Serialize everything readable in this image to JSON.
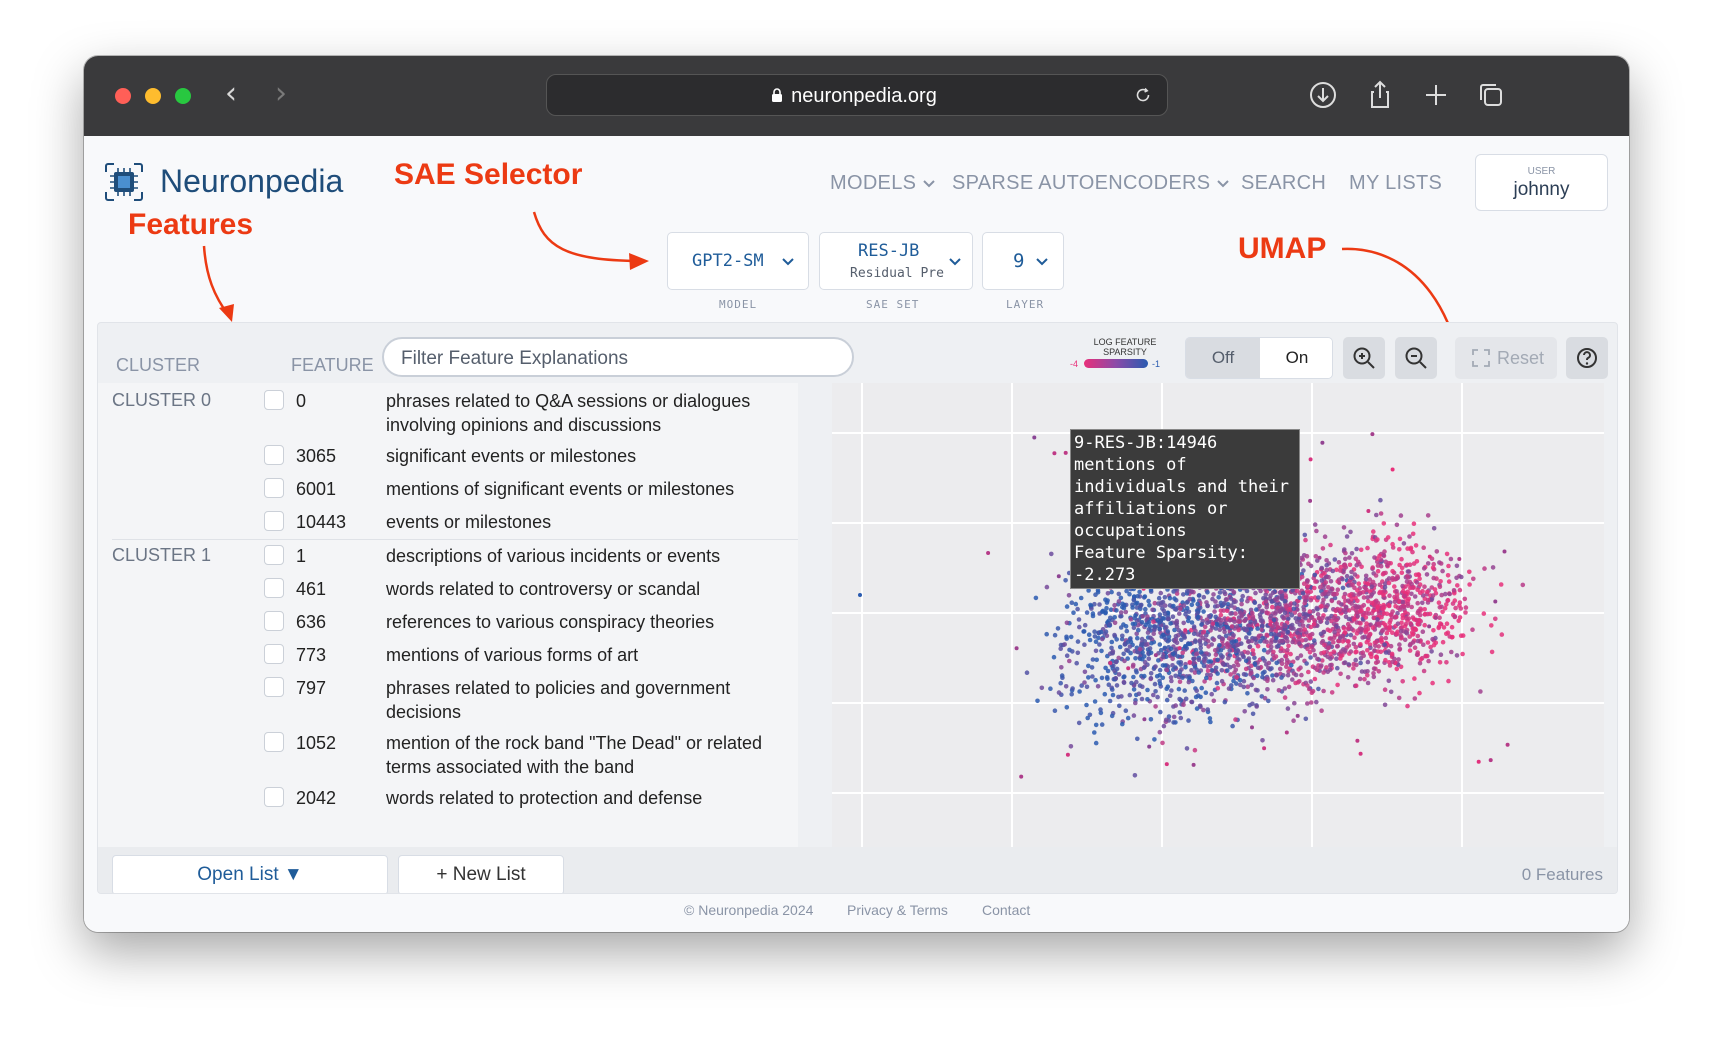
{
  "browser": {
    "url": "neuronpedia.org",
    "icons": [
      "back-icon",
      "forward-icon",
      "lock-icon",
      "reload-icon",
      "download-icon",
      "share-icon",
      "new-tab-icon",
      "tabs-icon"
    ]
  },
  "header": {
    "brand": "Neuronpedia",
    "nav": {
      "models": "MODELS",
      "sparse_autoencoders": "SPARSE AUTOENCODERS",
      "search": "SEARCH",
      "my_lists": "MY LISTS"
    },
    "user": {
      "label": "USER",
      "name": "johnny"
    }
  },
  "annotations": {
    "sae_selector": "SAE Selector",
    "features": "Features",
    "umap": "UMAP",
    "color": "#ec3a13"
  },
  "selectors": {
    "model": {
      "value": "GPT2-SM",
      "label": "MODEL"
    },
    "sae_set": {
      "value": "RES-JB",
      "sub": "Residual Pre",
      "label": "SAE SET"
    },
    "layer": {
      "value": "9",
      "label": "LAYER"
    }
  },
  "feature_list": {
    "cluster_header": "CLUSTER",
    "feature_header": "FEATURE",
    "filter_placeholder": "Filter Feature Explanations",
    "clusters": [
      {
        "name": "CLUSTER 0",
        "features": [
          {
            "id": "0",
            "desc": "phrases related to Q&A sessions or dialogues involving opinions and discussions"
          },
          {
            "id": "3065",
            "desc": "significant events or milestones"
          },
          {
            "id": "6001",
            "desc": "mentions of significant events or milestones"
          },
          {
            "id": "10443",
            "desc": "events or milestones"
          }
        ]
      },
      {
        "name": "CLUSTER 1",
        "features": [
          {
            "id": "1",
            "desc": "descriptions of various incidents or events"
          },
          {
            "id": "461",
            "desc": "words related to controversy or scandal"
          },
          {
            "id": "636",
            "desc": "references to various conspiracy theories"
          },
          {
            "id": "773",
            "desc": "mentions of various forms of art"
          },
          {
            "id": "797",
            "desc": "phrases related to policies and government decisions"
          },
          {
            "id": "1052",
            "desc": "mention of the rock band \"The Dead\" or related terms associated with the band"
          },
          {
            "id": "2042",
            "desc": "words related to protection and defense"
          }
        ]
      }
    ]
  },
  "umap": {
    "legend_title": "LOG FEATURE SPARSITY",
    "legend_min": "-4",
    "legend_max": "-1",
    "color_low": "#e8307a",
    "color_high": "#2a5bb0",
    "toggle_off": "Off",
    "toggle_on": "On",
    "reset": "Reset",
    "icons": [
      "zoom-in-icon",
      "zoom-out-icon",
      "reset-icon",
      "help-icon"
    ],
    "tooltip": {
      "title": "9-RES-JB:14946",
      "desc": "mentions of individuals and their affiliations or occupations",
      "sparsity": "Feature Sparsity: -2.273"
    }
  },
  "footer_bar": {
    "open_list": "Open List ▼",
    "new_list": "+ New List",
    "count": "0 Features"
  },
  "footer": {
    "copyright": "© Neuronpedia 2024",
    "privacy": "Privacy & Terms",
    "contact": "Contact"
  }
}
